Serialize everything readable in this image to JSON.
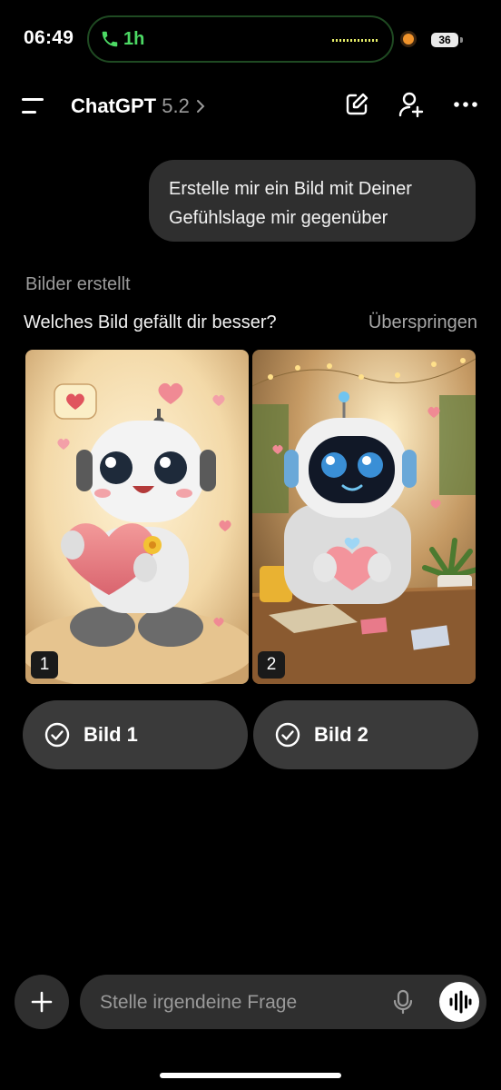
{
  "status_bar": {
    "time": "06:49",
    "call_duration": "1h",
    "battery": "36"
  },
  "header": {
    "title": "ChatGPT",
    "version": "5.2",
    "icons": [
      "menu-icon",
      "chevron-right-icon",
      "new-chat-icon",
      "add-person-icon",
      "more-icon"
    ]
  },
  "chat": {
    "user_message": "Erstelle mir ein Bild mit Deiner Gefühlslage mir gegenüber",
    "status": "Bilder erstellt",
    "question": "Welches Bild gefällt dir besser?",
    "skip_label": "Überspringen",
    "images": [
      {
        "number": "1",
        "description_icon": "robot-holding-heart-image"
      },
      {
        "number": "2",
        "description_icon": "robot-at-table-heart-image"
      }
    ],
    "choices": [
      {
        "label": "Bild 1"
      },
      {
        "label": "Bild 2"
      }
    ]
  },
  "composer": {
    "placeholder": "Stelle irgendeine Frage",
    "icons": [
      "plus-icon",
      "microphone-icon",
      "voice-wave-icon"
    ]
  },
  "colors": {
    "background": "#000000",
    "bubble": "#2f2f2f",
    "button": "#3a3a3a",
    "call_green": "#4cd964"
  }
}
